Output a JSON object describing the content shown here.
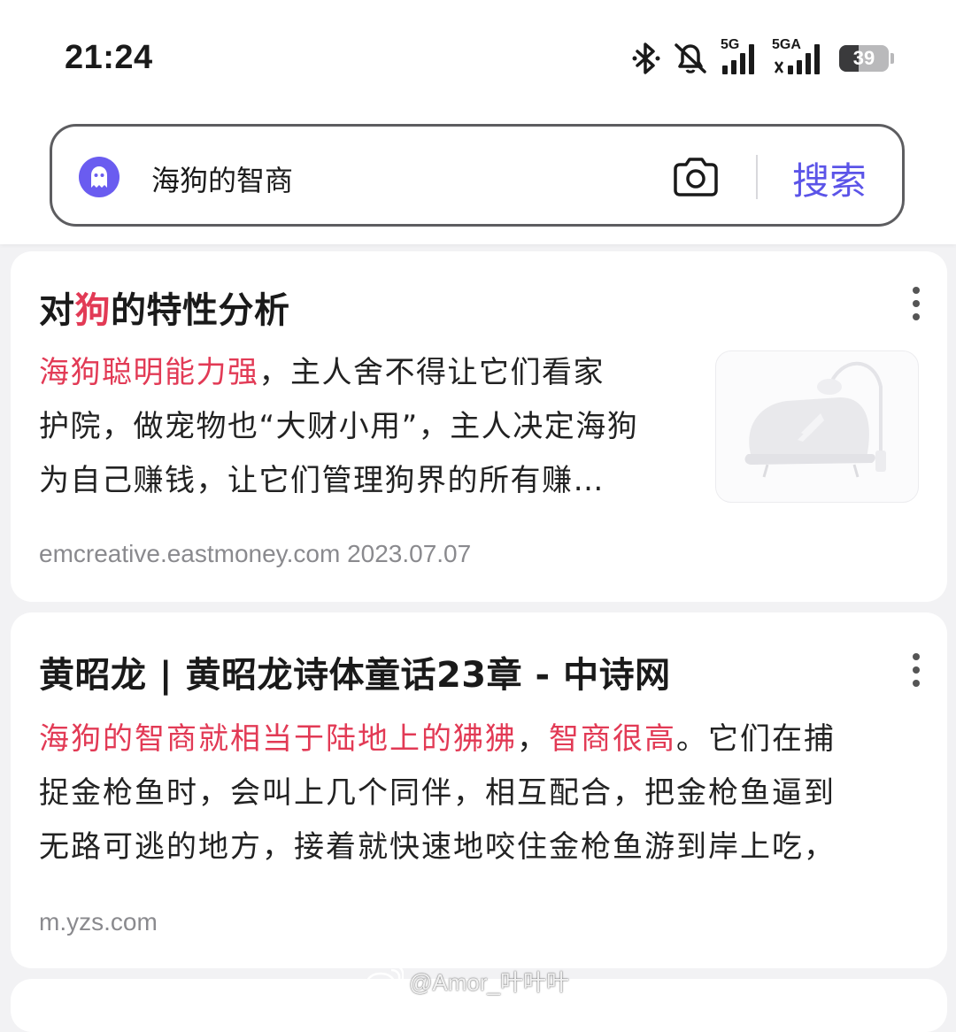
{
  "status_bar": {
    "time": "21:24",
    "icons": [
      "bluetooth-icon",
      "muted-bell-icon",
      "signal-5g-icon",
      "signal-5ga-icon",
      "battery-icon"
    ],
    "network_1": "5G",
    "network_2": "5GA",
    "battery_level": "39"
  },
  "search": {
    "query": "海狗的智商",
    "button_label": "搜索",
    "accent_color": "#5b54e8"
  },
  "results": [
    {
      "title_pre": "对",
      "title_hl": "狗",
      "title_post": "的特性分析",
      "snippet_lines": [
        {
          "hl": "海狗聪明能力强",
          "text": "，主人舍不得让它们看家"
        },
        {
          "hl": "",
          "text": "护院，做宠物也“大财小用”，主人决定海狗"
        },
        {
          "hl": "",
          "text": "为自己赚钱，让它们管理狗界的所有赚…"
        }
      ],
      "source": "emcreative.eastmoney.com",
      "date": "2023.07.07"
    },
    {
      "title": "黄昭龙 | 黄昭龙诗体童话23章 - 中诗网",
      "snippet_line1_hl1": "海狗的智商就相当于陆地上的狒狒",
      "snippet_line1_sep": "，",
      "snippet_line1_hl2": "智商很高",
      "snippet_line1_post": "。它们在捕",
      "snippet_line2": "捉金枪鱼时，会叫上几个同伴，相互配合，把金枪鱼逼到",
      "snippet_line3": "无路可逃的地方，接着就快速地咬住金枪鱼游到岸上吃，",
      "source": "m.yzs.com"
    }
  ],
  "highlight_color": "#e23a55",
  "watermark": "@Amor_叶叶叶"
}
